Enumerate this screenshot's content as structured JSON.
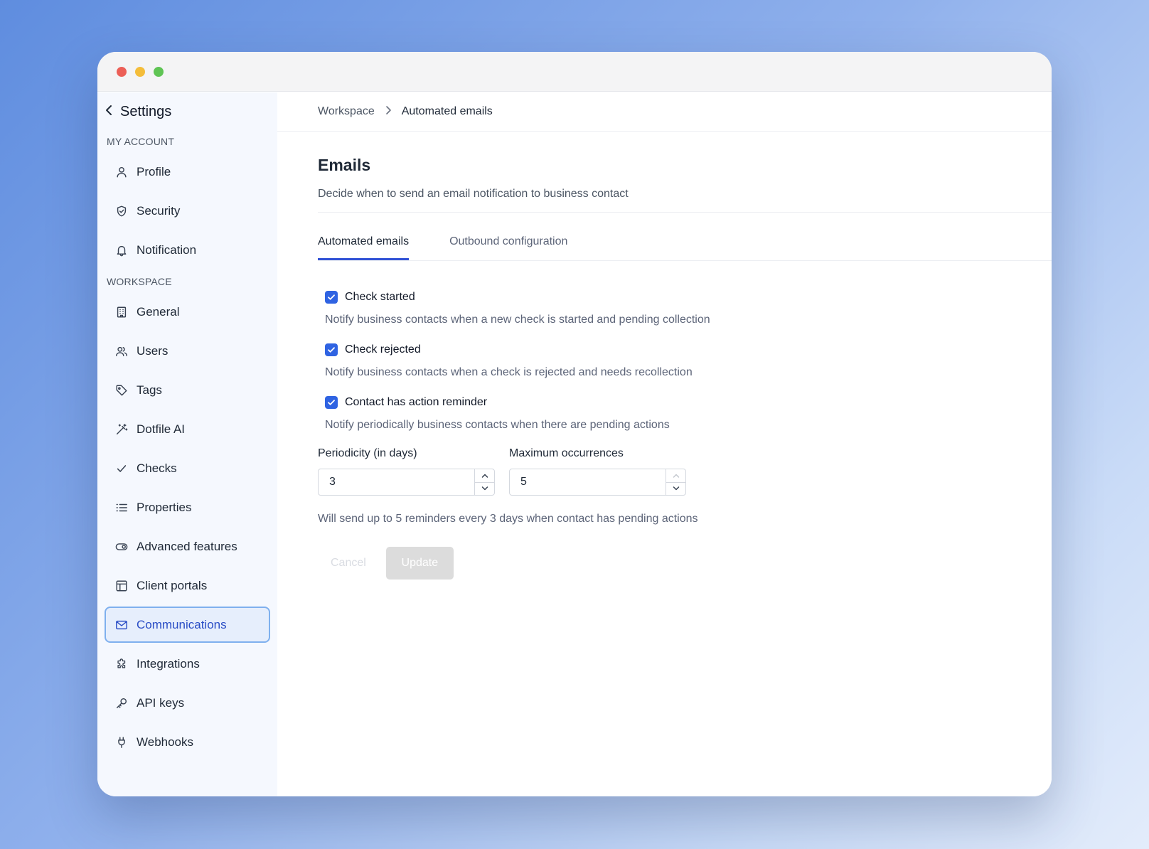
{
  "window": {
    "controls": [
      "close",
      "minimize",
      "maximize"
    ]
  },
  "sidebar": {
    "title": "Settings",
    "back_icon": "chevron-left-icon",
    "sections": {
      "my_account": {
        "label": "MY ACCOUNT",
        "items": [
          {
            "label": "Profile",
            "icon": "user-icon"
          },
          {
            "label": "Security",
            "icon": "shield-icon"
          },
          {
            "label": "Notification",
            "icon": "bell-icon"
          }
        ]
      },
      "workspace": {
        "label": "WORKSPACE",
        "items": [
          {
            "label": "General",
            "icon": "building-icon"
          },
          {
            "label": "Users",
            "icon": "users-icon"
          },
          {
            "label": "Tags",
            "icon": "tag-icon"
          },
          {
            "label": "Dotfile AI",
            "icon": "magic-wand-icon"
          },
          {
            "label": "Checks",
            "icon": "check-icon"
          },
          {
            "label": "Properties",
            "icon": "list-icon"
          },
          {
            "label": "Advanced features",
            "icon": "toggle-icon"
          },
          {
            "label": "Client portals",
            "icon": "layout-icon"
          },
          {
            "label": "Communications",
            "icon": "mail-icon",
            "active": true
          },
          {
            "label": "Integrations",
            "icon": "puzzle-icon"
          },
          {
            "label": "API keys",
            "icon": "key-icon"
          },
          {
            "label": "Webhooks",
            "icon": "plug-icon"
          }
        ]
      }
    }
  },
  "breadcrumb": {
    "parent": "Workspace",
    "separator": ">",
    "current": "Automated emails"
  },
  "page": {
    "title": "Emails",
    "description": "Decide when to send an email notification to business contact"
  },
  "tabs": [
    {
      "label": "Automated emails",
      "active": true
    },
    {
      "label": "Outbound configuration",
      "active": false
    }
  ],
  "options": [
    {
      "label": "Check started",
      "checked": true,
      "help": "Notify business contacts when a new check is started and pending collection"
    },
    {
      "label": "Check rejected",
      "checked": true,
      "help": "Notify business contacts when a check is rejected and needs recollection"
    },
    {
      "label": "Contact has action reminder",
      "checked": true,
      "help": "Notify periodically business contacts when there are pending actions"
    }
  ],
  "fields": {
    "periodicity": {
      "label": "Periodicity (in days)",
      "value": "3"
    },
    "max_occurrences": {
      "label": "Maximum occurrences",
      "value": "5"
    }
  },
  "summary": "Will send up to 5 reminders every 3 days when contact has pending actions",
  "actions": {
    "cancel": "Cancel",
    "update": "Update"
  },
  "colors": {
    "accent": "#2f63e2",
    "active_nav_bg": "#e6eefc",
    "active_nav_border": "#7fb0ee",
    "active_nav_text": "#2b4ec6"
  }
}
